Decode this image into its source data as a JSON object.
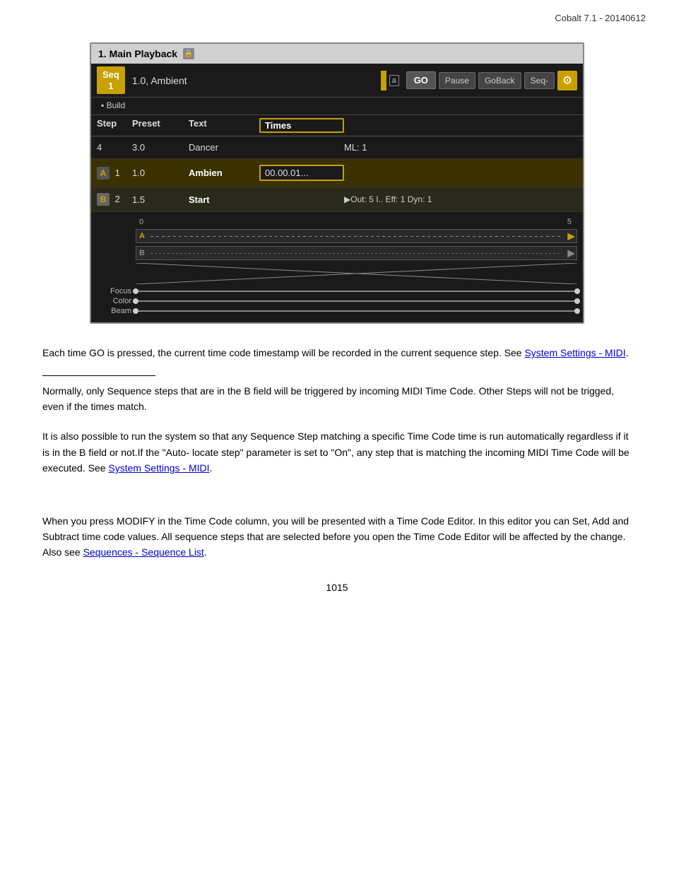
{
  "header": {
    "version": "Cobalt 7.1 - 20140612"
  },
  "panel": {
    "title": "1. Main Playback",
    "seq_badge": "Seq\n1",
    "seq_label": "1.0, Ambient",
    "btn_go": "GO",
    "btn_pause": "Pause",
    "btn_goback": "GoBack",
    "btn_seq": "Seq-",
    "build_label": "▪ Build",
    "columns": {
      "step": "Step",
      "preset": "Preset",
      "text": "Text",
      "times": "Times"
    },
    "row_empty": {
      "step": "4",
      "preset": "3.0",
      "text": "Dancer",
      "extra": "ML: 1"
    },
    "row_a": {
      "marker": "A",
      "step": "1",
      "preset": "1.0",
      "text": "Ambien",
      "timecode": "00.00.01..."
    },
    "row_b": {
      "marker": "B",
      "step": "2",
      "preset": "1.5",
      "text": "Start",
      "extra": "▶Out: 5   I..   Eff: 1   Dyn: 1"
    },
    "timeline": {
      "scale_start": "0",
      "scale_end": "5",
      "track_a_label": "",
      "track_b_label": "",
      "focus_label": "Focus",
      "color_label": "Color",
      "beam_label": "Beam"
    }
  },
  "body": {
    "para1": "Each time GO is pressed, the current time code timestamp will be recorded in the current sequence step. See ",
    "para1_link": "System Settings - MIDI",
    "para1_end": ".",
    "para2": "Normally, only Sequence steps that are in the B field will be triggered by incoming MIDI Time Code. Other Steps will not be trigged, even if the times match.",
    "para3_start": "It is also possible to run the system so that any Sequence Step matching a specific Time Code time is run automatically regardless if it is in the B field or not.If the \"Auto- locate step\" parameter is set to \"On\", any step that is matching the incoming MIDI Time Code will be executed. See ",
    "para3_link": "System Settings - MIDI",
    "para3_end": ".",
    "para4_start": "When you press MODIFY in the Time Code column, you will be presented with a Time Code Editor. In this editor you can Set, Add and Subtract time code values. All sequence steps that are selected before you open the Time Code Editor will be affected by the change. Also see ",
    "para4_link": "Sequences - Sequence List",
    "para4_end": ".",
    "page_number": "1015"
  }
}
